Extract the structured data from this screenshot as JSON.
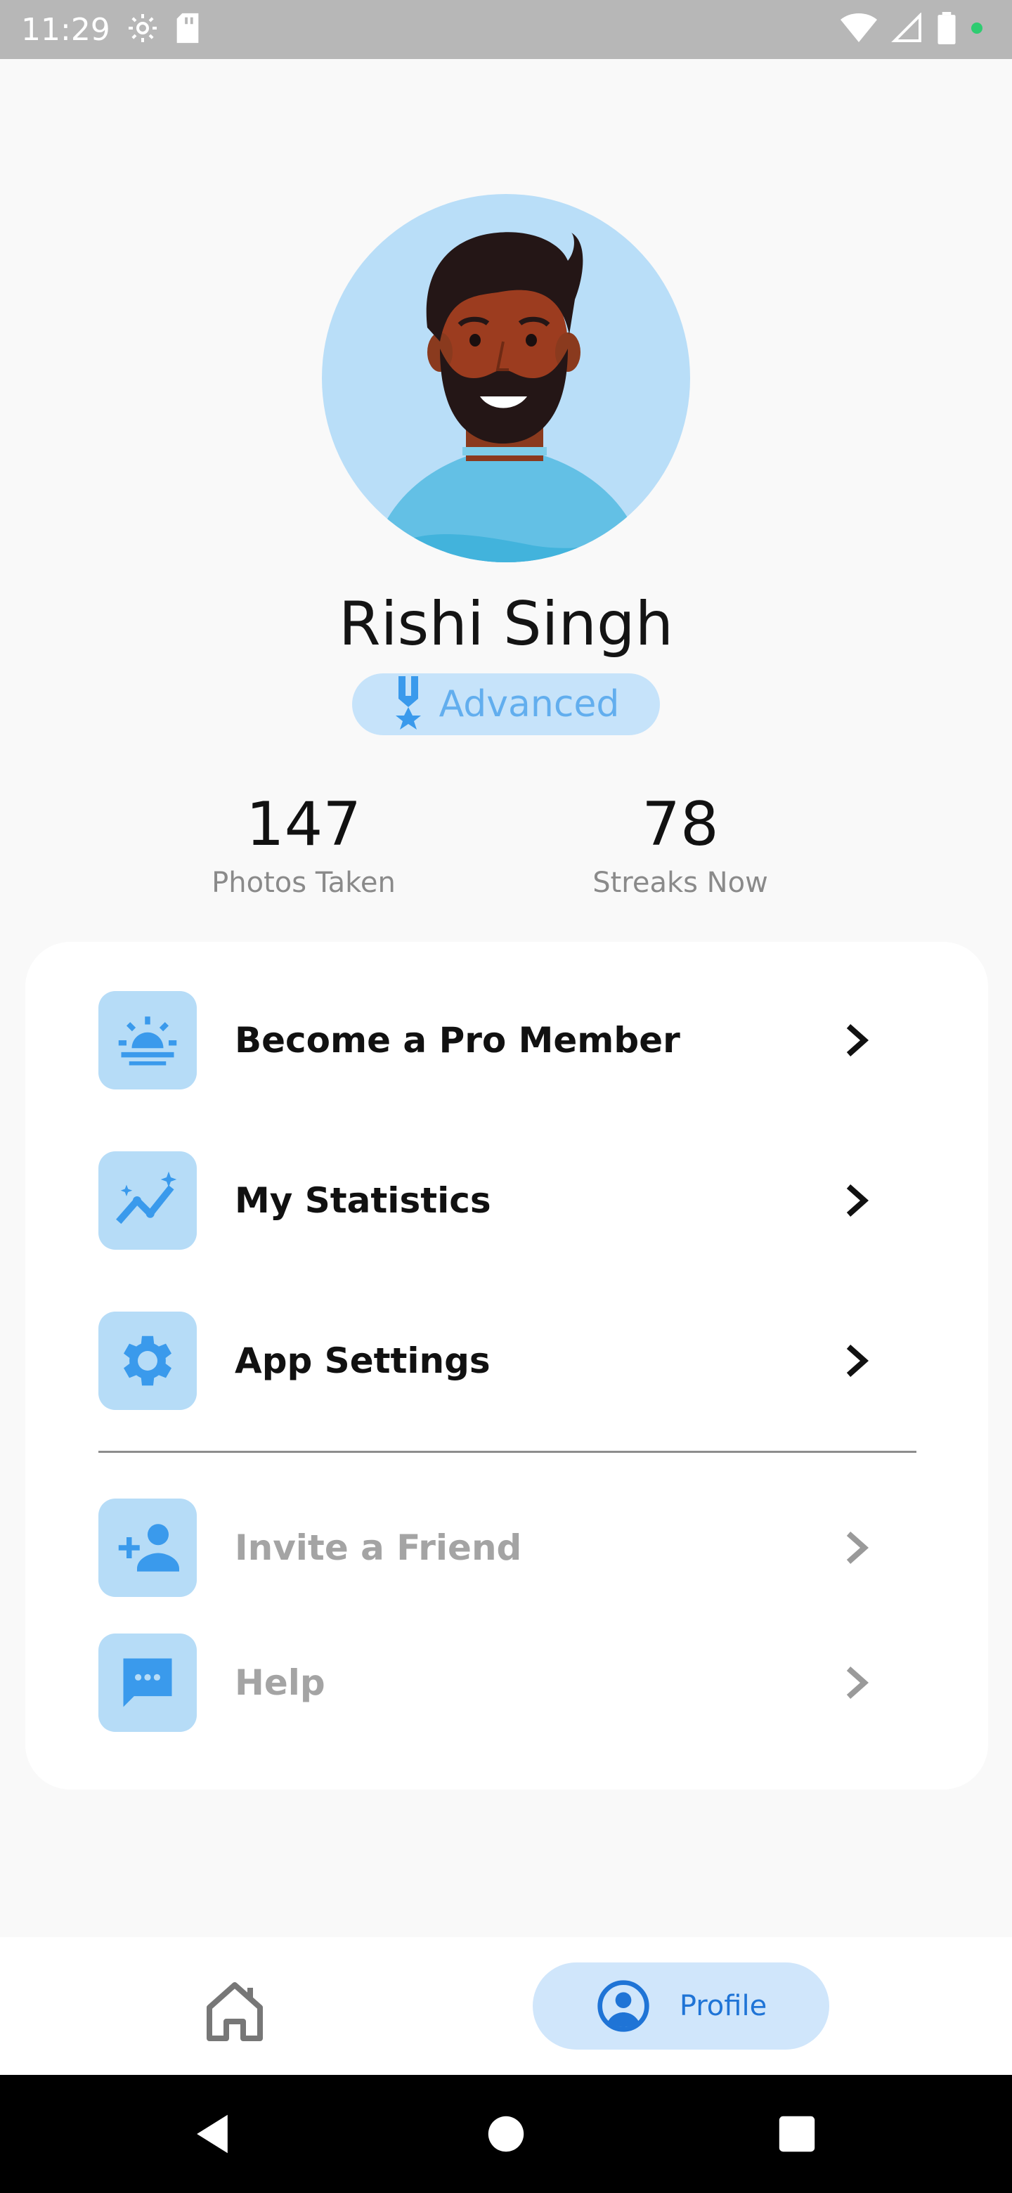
{
  "status_bar": {
    "time": "11:29",
    "left_icons": [
      "settings-icon",
      "sd-card-icon"
    ],
    "right_icons": [
      "wifi-icon",
      "signal-icon",
      "battery-icon",
      "dot-icon"
    ],
    "dot_color": "#2ecc71"
  },
  "profile": {
    "name": "Rishi Singh",
    "level": "Advanced",
    "avatar_bg": "#b9def8"
  },
  "stats": [
    {
      "value": "147",
      "label": "Photos Taken"
    },
    {
      "value": "78",
      "label": "Streaks Now"
    }
  ],
  "menu": {
    "primary": [
      {
        "label": "Become a Pro Member",
        "icon": "sunrise-icon"
      },
      {
        "label": "My Statistics",
        "icon": "trending-up-icon"
      },
      {
        "label": "App Settings",
        "icon": "gear-icon"
      }
    ],
    "secondary": [
      {
        "label": "Invite a Friend",
        "icon": "add-person-icon"
      },
      {
        "label": "Help",
        "icon": "chat-icon"
      }
    ]
  },
  "bottom_nav": {
    "home_icon": "home-icon",
    "profile_label": "Profile",
    "active": "Profile"
  },
  "colors": {
    "accent": "#1f74d6",
    "icon_blue": "#3a9aec",
    "icon_bg": "#b6dcf7",
    "badge_bg": "#c6e3fa",
    "badge_text": "#62aeee"
  }
}
